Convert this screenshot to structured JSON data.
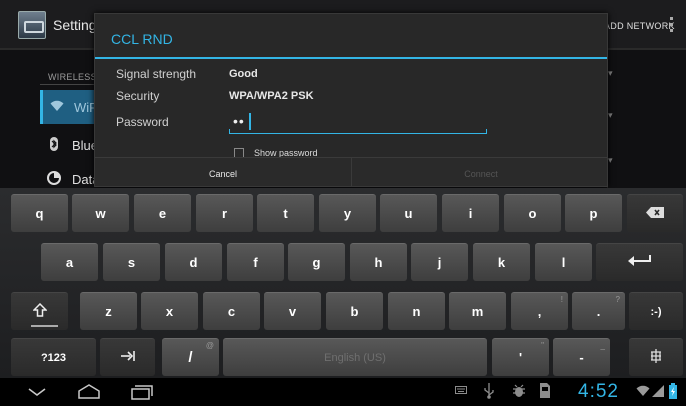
{
  "background": {
    "app_title": "Settings",
    "add_network": "ADD NETWORK",
    "section_header": "WIRELESS",
    "items": [
      {
        "label": "WiFi",
        "icon": "wifi-icon"
      },
      {
        "label": "Blue",
        "icon": "bluetooth-icon"
      },
      {
        "label": "Data",
        "icon": "data-usage-icon"
      }
    ]
  },
  "dialog": {
    "title": "CCL RND",
    "signal_label": "Signal strength",
    "signal_value": "Good",
    "security_label": "Security",
    "security_value": "WPA/WPA2 PSK",
    "password_label": "Password",
    "password_value": "••",
    "show_password_label": "Show password",
    "show_password_checked": false,
    "cancel_label": "Cancel",
    "connect_label": "Connect",
    "connect_enabled": false,
    "accent_color": "#33b5e5"
  },
  "keyboard": {
    "row1": [
      "q",
      "w",
      "e",
      "r",
      "t",
      "y",
      "u",
      "i",
      "o",
      "p"
    ],
    "row2": [
      "a",
      "s",
      "d",
      "f",
      "g",
      "h",
      "j",
      "k",
      "l"
    ],
    "row3": [
      "z",
      "x",
      "c",
      "v",
      "b",
      "n",
      "m"
    ],
    "comma": ",",
    "comma_hint": "!",
    "period": ".",
    "period_hint": "?",
    "smiley": ":-)",
    "symbols_key": "?123",
    "slash": "/",
    "slash_hint": "@",
    "space_label": "English (US)",
    "apostrophe": "'",
    "apostrophe_hint": "\"",
    "dash": "-",
    "dash_hint": "_",
    "icons": {
      "backspace": "backspace-icon",
      "enter": "enter-icon",
      "shift": "shift-icon",
      "tab": "tab-icon",
      "settings": "keyboard-settings-icon"
    }
  },
  "statusbar": {
    "clock": "4:52",
    "icons": [
      "keyboard-icon",
      "usb-icon",
      "debug-icon",
      "sd-card-icon",
      "wifi-signal-icon",
      "cell-signal-icon",
      "battery-icon"
    ]
  }
}
